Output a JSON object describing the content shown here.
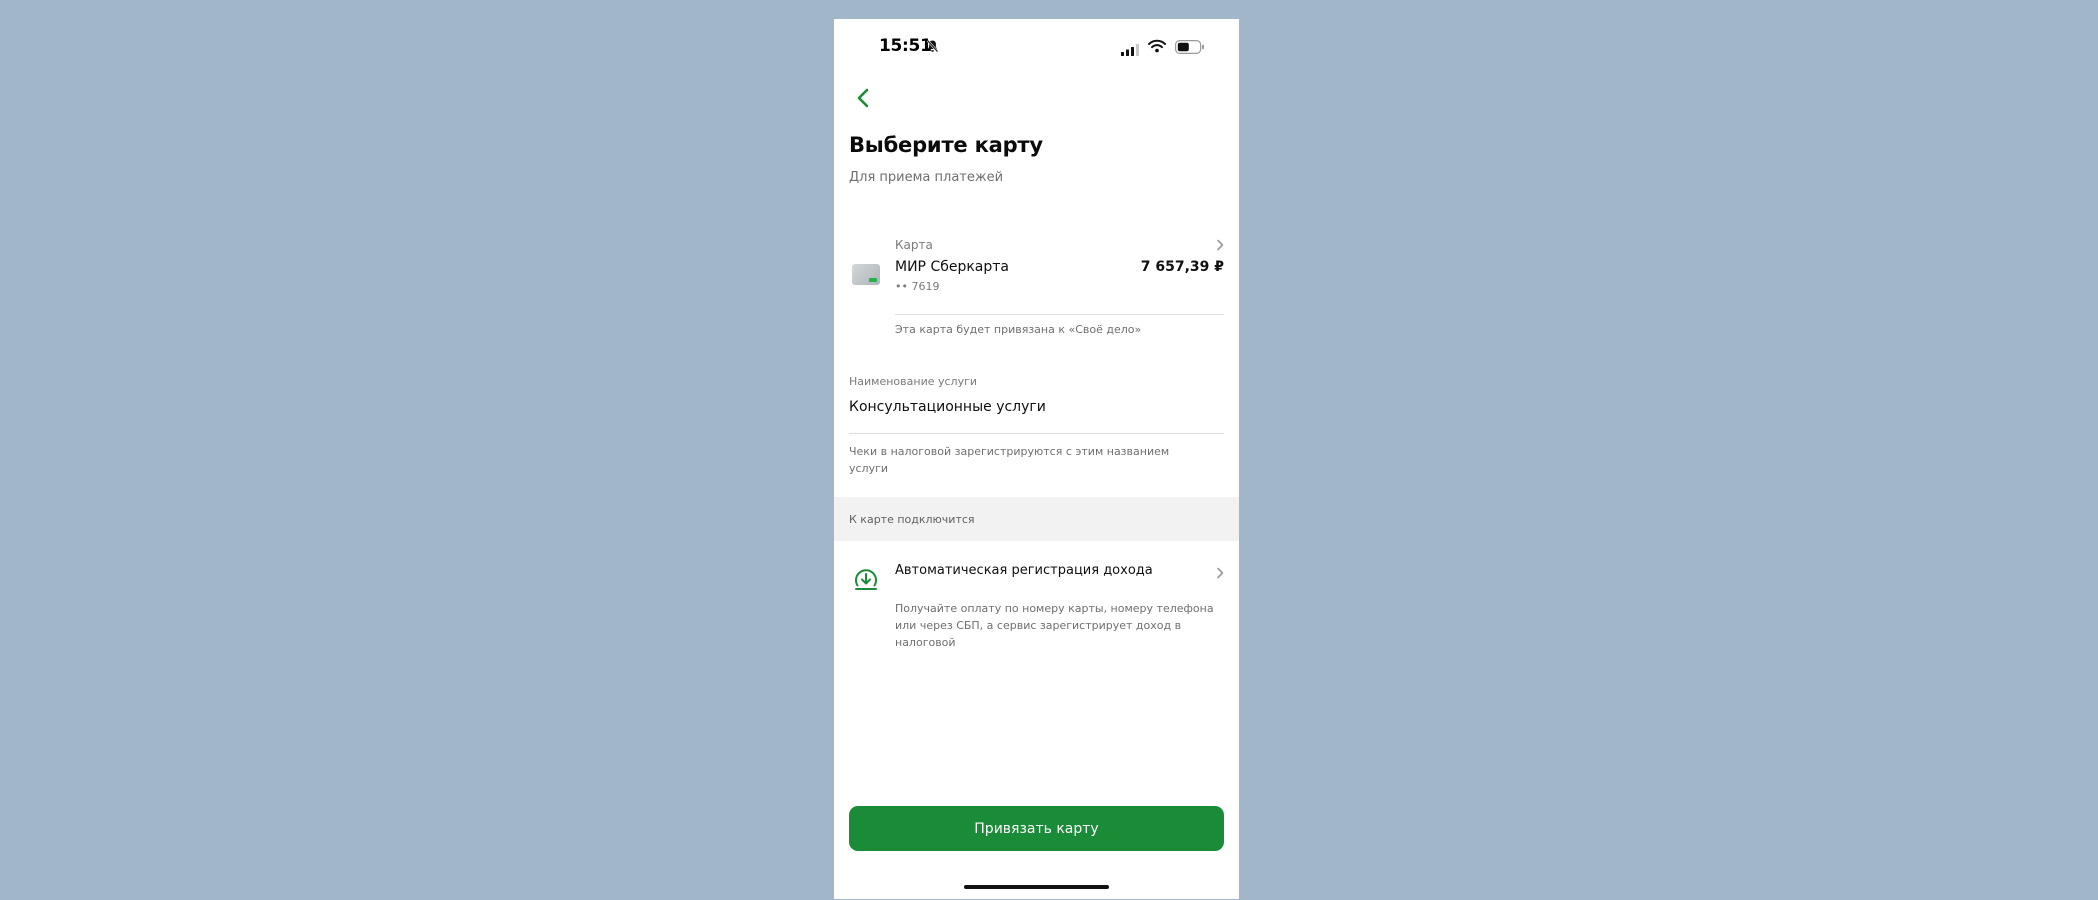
{
  "status_bar": {
    "time": "15:51",
    "icons": [
      "bell-off-icon",
      "signal-icon",
      "wifi-icon",
      "battery-icon"
    ]
  },
  "nav": {
    "back_icon": "chevron-left-icon"
  },
  "header": {
    "title": "Выберите карту",
    "subtitle": "Для приема платежей"
  },
  "card": {
    "caption": "Карта",
    "name": "МИР Сберкарта",
    "number": "•• 7619",
    "amount": "7 657,39 ₽",
    "note": "Эта карта будет привязана к «Своё дело»"
  },
  "service": {
    "label": "Наименование услуги",
    "value": "Консультационные услуги",
    "note": "Чеки в налоговой зарегистрируются с этим названием услуги"
  },
  "section": {
    "title": "К карте подключится"
  },
  "feature": {
    "icon": "download-circle-icon",
    "title": "Автоматическая регистрация дохода",
    "description": "Получайте оплату по номеру карты, номеру телефона или через СБП, а сервис зарегистрирует доход в налоговой"
  },
  "actions": {
    "primary_label": "Привязать карту"
  },
  "colors": {
    "accent": "#1a8b37",
    "background": "#a1b6c8"
  }
}
